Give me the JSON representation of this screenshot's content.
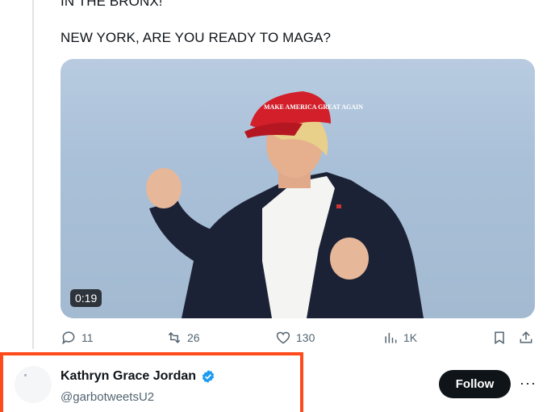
{
  "tweet": {
    "text_line1": "IN THE BRONX!",
    "text_line2": "NEW YORK, ARE YOU READY TO MAGA?",
    "media": {
      "duration": "0:19",
      "hat_text": "MAKE AMERICA GREAT AGAIN"
    },
    "actions": {
      "replies": "11",
      "reposts": "26",
      "likes": "130",
      "views": "1K"
    }
  },
  "reply_account": {
    "name": "Kathryn Grace Jordan",
    "handle": "@garbotweetsU2",
    "follow_label": "Follow",
    "more_label": "···"
  },
  "colors": {
    "highlight_border": "#ff4a1c",
    "verified_blue": "#1d9bf0",
    "icon_gray": "#536471"
  }
}
